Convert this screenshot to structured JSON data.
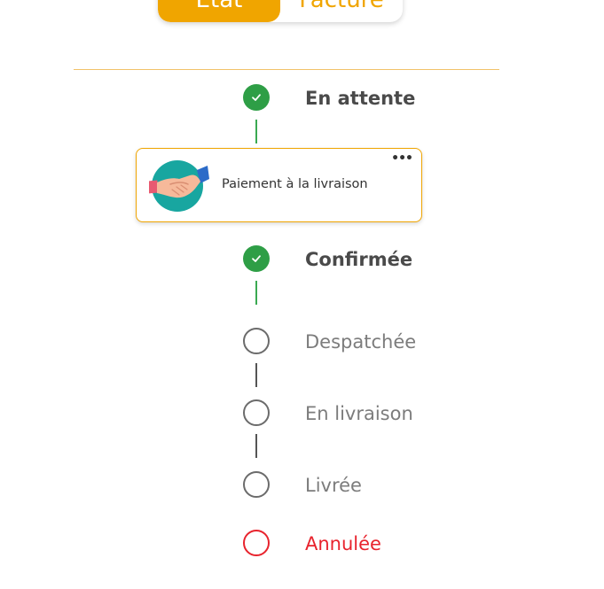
{
  "tabs": [
    {
      "label": "Etat",
      "active": true
    },
    {
      "label": "Facture",
      "active": false
    }
  ],
  "timeline": [
    {
      "label": "En attente",
      "status": "done"
    },
    {
      "label": "Confirmée",
      "status": "done"
    },
    {
      "label": "Despatchée",
      "status": "pending"
    },
    {
      "label": "En livraison",
      "status": "pending"
    },
    {
      "label": "Livrée",
      "status": "pending"
    },
    {
      "label": "Annulée",
      "status": "cancelled"
    }
  ],
  "payment_card": {
    "text": "Paiement à la livraison",
    "icon": "handshake-icon",
    "menu_icon": "more-horizontal-icon"
  },
  "colors": {
    "accent": "#f0a500",
    "done": "#2e9e46",
    "pending": "#6b6b6b",
    "cancelled": "#e8232d"
  }
}
